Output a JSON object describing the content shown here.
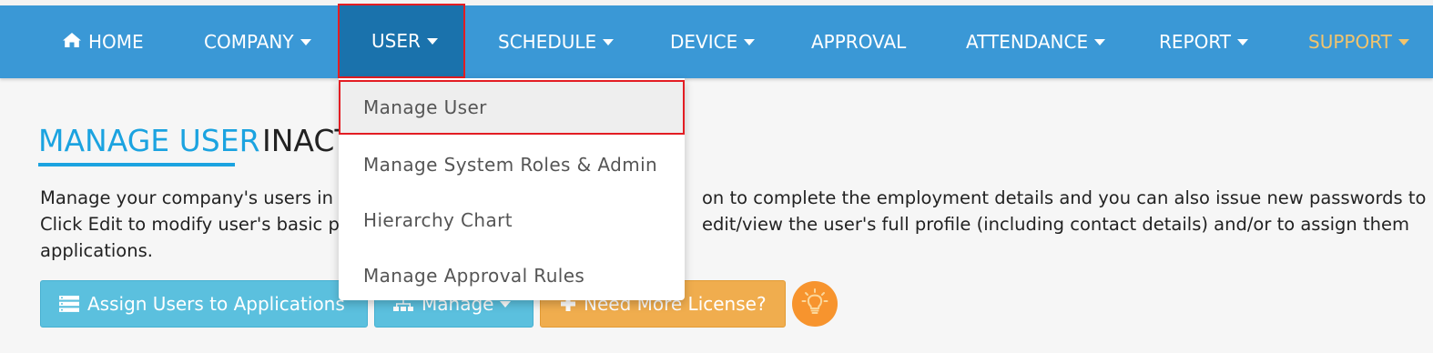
{
  "nav": {
    "home": "HOME",
    "company": "COMPANY",
    "user": "USER",
    "schedule": "SCHEDULE",
    "device": "DEVICE",
    "approval": "APPROVAL",
    "attendance": "ATTENDANCE",
    "report": "REPORT",
    "support": "SUPPORT"
  },
  "dropdown": {
    "items": [
      "Manage User",
      "Manage System Roles & Admin",
      "Hierarchy Chart",
      "Manage Approval Rules"
    ]
  },
  "tabs": {
    "manage_user": "MANAGE USER",
    "inactive": "INACT"
  },
  "description": {
    "line1_left": "Manage your company's users in",
    "line1_right": "on to complete the employment details and you can also issue new passwords to",
    "line2_left": "Click Edit to modify user's basic p",
    "line2_right": "edit/view the user's full profile (including contact details) and/or to assign them",
    "line3": "applications."
  },
  "buttons": {
    "assign": "Assign Users to Applications",
    "manage": "Manage",
    "license": "Need More License?"
  },
  "colors": {
    "navbar": "#3a98d6",
    "nav_active": "#1a72ac",
    "highlight_border": "#e31d23",
    "tab_accent": "#1ba3e0",
    "info_button": "#5bc0de",
    "warning_button": "#f0ad4e",
    "support_text": "#f2c46d",
    "bulb": "#f7942e"
  },
  "icons": {
    "home": "home-icon",
    "assign": "list-icon",
    "manage": "sitemap-icon",
    "license": "plus-icon",
    "bulb": "lightbulb-icon"
  }
}
